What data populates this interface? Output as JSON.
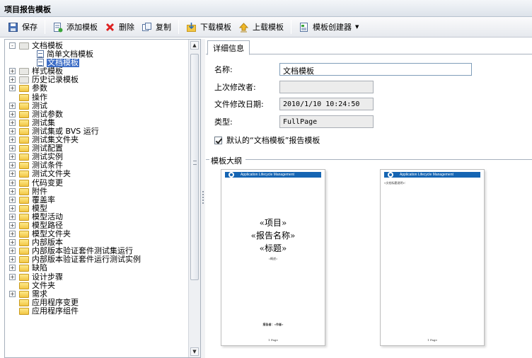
{
  "window": {
    "title": "项目报告模板"
  },
  "toolbar": {
    "save": "保存",
    "add_template": "添加模板",
    "delete": "删除",
    "copy": "复制",
    "download": "下载模板",
    "upload": "上载模板",
    "creator": "模板创建器"
  },
  "tree": {
    "nodes": [
      {
        "label": "文档模板",
        "exp": "-",
        "icon": "gray",
        "level": 0
      },
      {
        "label": "简单文档模板",
        "exp": "",
        "icon": "doc",
        "level": 1
      },
      {
        "label": "文档模板",
        "exp": "",
        "icon": "doc",
        "level": 1,
        "selected": true
      },
      {
        "label": "样式模板",
        "exp": "+",
        "icon": "gray",
        "level": 0
      },
      {
        "label": "历史记录模板",
        "exp": "+",
        "icon": "gray",
        "level": 0
      },
      {
        "label": "参数",
        "exp": "+",
        "icon": "yel",
        "level": 0
      },
      {
        "label": "操作",
        "exp": "",
        "icon": "yel",
        "level": 0
      },
      {
        "label": "测试",
        "exp": "+",
        "icon": "yel",
        "level": 0
      },
      {
        "label": "测试参数",
        "exp": "+",
        "icon": "yel",
        "level": 0
      },
      {
        "label": "测试集",
        "exp": "+",
        "icon": "yel",
        "level": 0
      },
      {
        "label": "测试集或 BVS 运行",
        "exp": "+",
        "icon": "yel",
        "level": 0
      },
      {
        "label": "测试集文件夹",
        "exp": "+",
        "icon": "yel",
        "level": 0
      },
      {
        "label": "测试配置",
        "exp": "+",
        "icon": "yel",
        "level": 0
      },
      {
        "label": "测试实例",
        "exp": "+",
        "icon": "yel",
        "level": 0
      },
      {
        "label": "测试条件",
        "exp": "+",
        "icon": "yel",
        "level": 0
      },
      {
        "label": "测试文件夹",
        "exp": "+",
        "icon": "yel",
        "level": 0
      },
      {
        "label": "代码变更",
        "exp": "+",
        "icon": "yel",
        "level": 0
      },
      {
        "label": "附件",
        "exp": "+",
        "icon": "yel",
        "level": 0
      },
      {
        "label": "覆盖率",
        "exp": "+",
        "icon": "yel",
        "level": 0
      },
      {
        "label": "模型",
        "exp": "+",
        "icon": "yel",
        "level": 0
      },
      {
        "label": "模型活动",
        "exp": "+",
        "icon": "yel",
        "level": 0
      },
      {
        "label": "模型路径",
        "exp": "+",
        "icon": "yel",
        "level": 0
      },
      {
        "label": "模型文件夹",
        "exp": "+",
        "icon": "yel",
        "level": 0
      },
      {
        "label": "内部版本",
        "exp": "+",
        "icon": "yel",
        "level": 0
      },
      {
        "label": "内部版本验证套件测试集运行",
        "exp": "+",
        "icon": "yel",
        "level": 0
      },
      {
        "label": "内部版本验证套件运行测试实例",
        "exp": "+",
        "icon": "yel",
        "level": 0
      },
      {
        "label": "缺陷",
        "exp": "+",
        "icon": "yel",
        "level": 0
      },
      {
        "label": "设计步骤",
        "exp": "+",
        "icon": "yel",
        "level": 0
      },
      {
        "label": "文件夹",
        "exp": "",
        "icon": "yel",
        "level": 0
      },
      {
        "label": "需求",
        "exp": "+",
        "icon": "yel",
        "level": 0
      },
      {
        "label": "应用程序变更",
        "exp": "",
        "icon": "yel",
        "level": 0
      },
      {
        "label": "应用程序组件",
        "exp": "",
        "icon": "yel",
        "level": 0
      }
    ]
  },
  "details": {
    "tab": "详细信息",
    "name_label": "名称:",
    "name_value": "文档模板",
    "modifier_label": "上次修改者:",
    "modifier_value": "",
    "date_label": "文件修改日期:",
    "date_value": "2010/1/10 10:24:50",
    "type_label": "类型:",
    "type_value": "FullPage",
    "default_checkbox": "默认的“文档模板”报告模板",
    "outline_label": "模板大纲"
  },
  "preview": {
    "app_title": "Application Lifecycle Management",
    "page1": {
      "line1": "«项目»",
      "line2": "«报告名称»",
      "line3": "«标题»",
      "small_mid": "«概述»",
      "small_bottom": "报告者：«作者»",
      "footer": "1 Page"
    },
    "page2": {
      "small_top": "«文档标题说明»：",
      "footer": "1 Page"
    }
  },
  "colors": {
    "accent": "#3b6cc6",
    "folder": "#f2c644",
    "hp_blue": "#1565b3"
  }
}
